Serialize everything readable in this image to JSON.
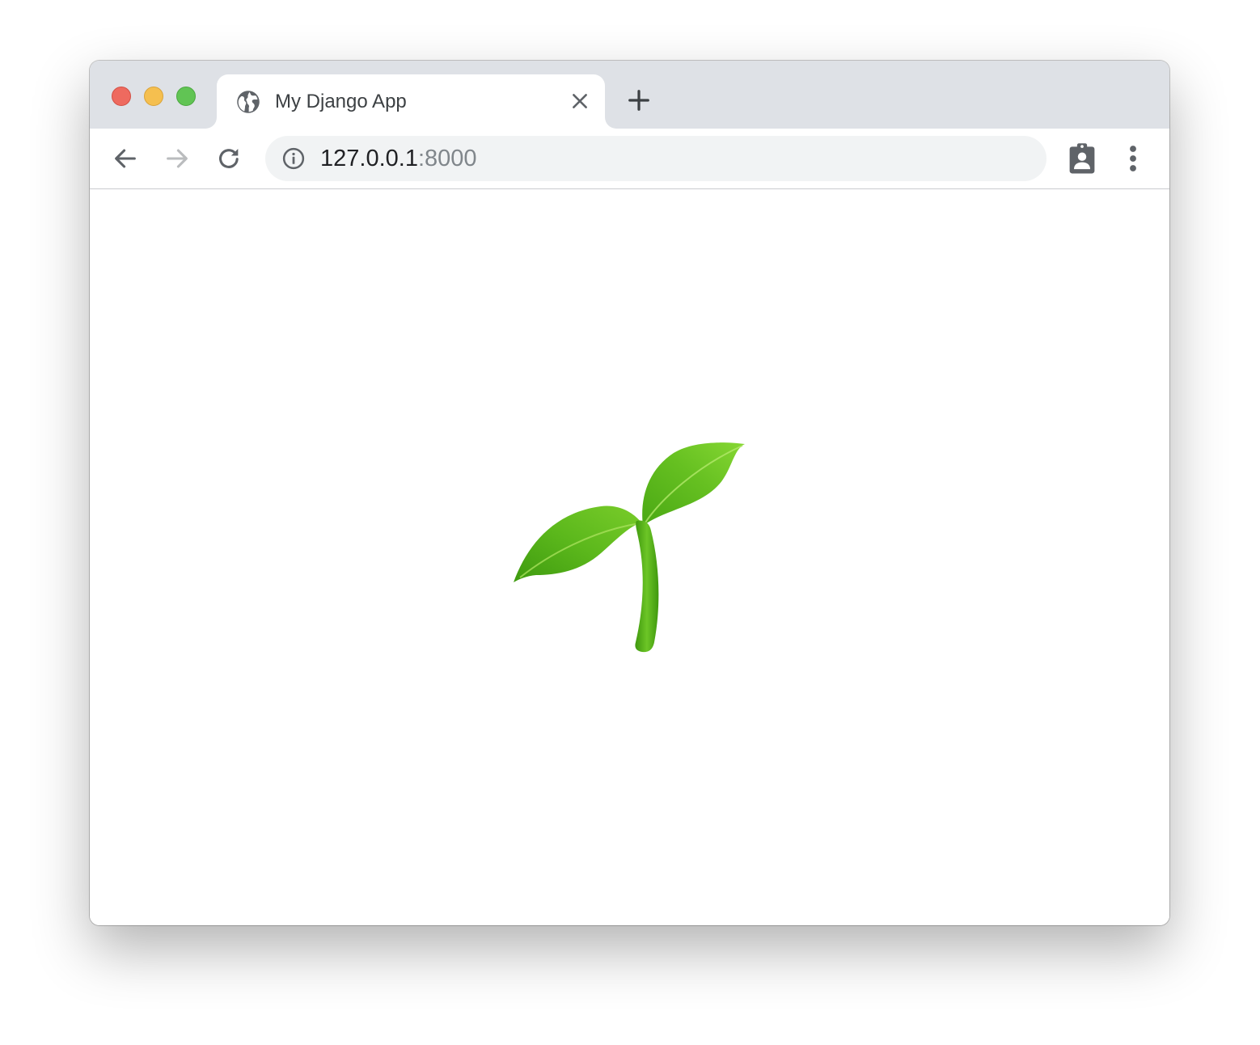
{
  "window": {
    "traffic_lights": {
      "close_color": "#ee6a5f",
      "minimize_color": "#f5bf4f",
      "maximize_color": "#61c454"
    }
  },
  "tab": {
    "title": "My Django App",
    "favicon": "globe-icon"
  },
  "toolbar": {
    "back_icon": "arrow-left-icon",
    "forward_icon": "arrow-right-icon",
    "reload_icon": "reload-icon",
    "profile_icon": "clipboard-account-icon",
    "menu_icon": "three-dots-vertical-icon"
  },
  "omnibox": {
    "info_icon": "info-circle-icon",
    "url_host": "127.0.0.1",
    "url_port": ":8000"
  },
  "content": {
    "image": "seedling-emoji",
    "accent_color": "#5cb81c"
  }
}
